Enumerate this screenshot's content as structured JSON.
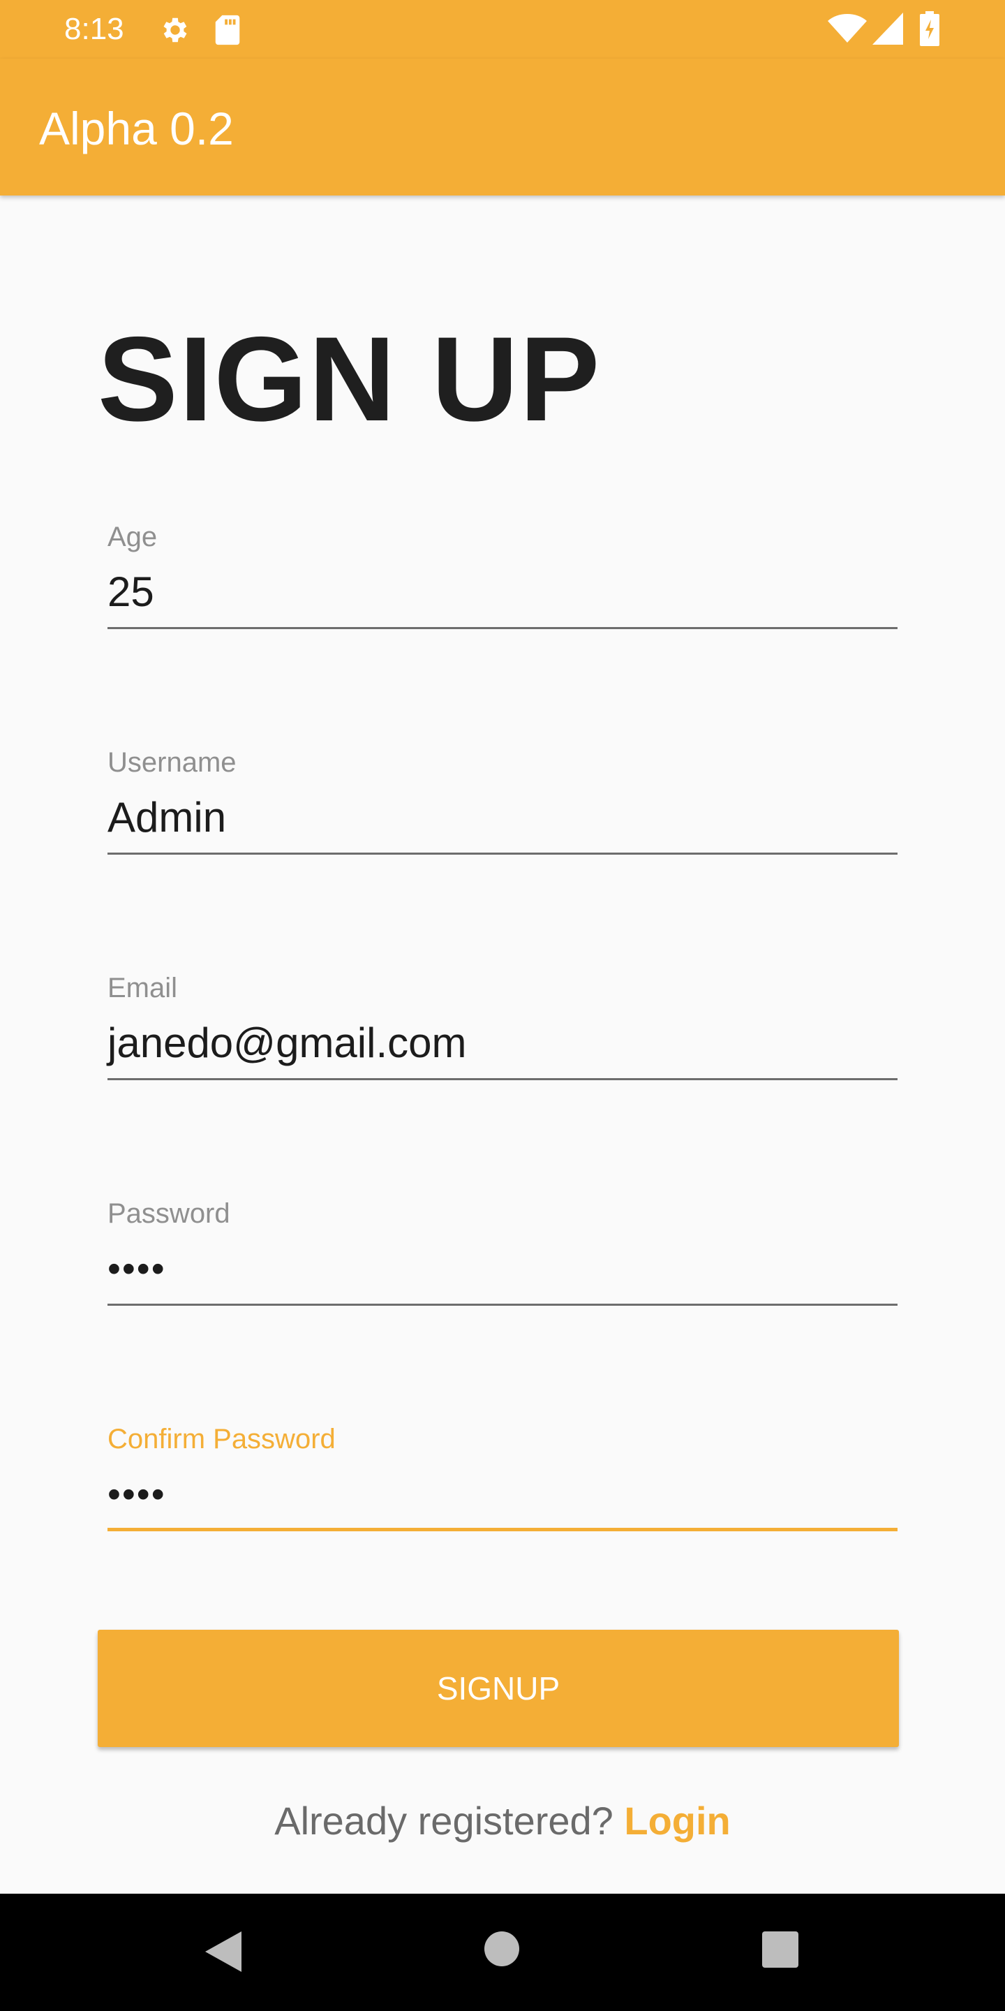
{
  "status_bar": {
    "time": "8:13",
    "left_icons": [
      "gear-icon",
      "sd-card-icon"
    ],
    "right_icons": [
      "wifi-icon",
      "cellular-signal-icon",
      "battery-charging-icon"
    ]
  },
  "app_bar": {
    "title": "Alpha 0.2"
  },
  "page": {
    "heading": "SIGN UP"
  },
  "form": {
    "fields": [
      {
        "label": "Age",
        "value": "25",
        "type": "text"
      },
      {
        "label": "Username",
        "value": "Admin",
        "type": "text"
      },
      {
        "label": "Email",
        "value": "janedo@gmail.com",
        "type": "email"
      },
      {
        "label": "Password",
        "value": "••••",
        "type": "password"
      },
      {
        "label": "Confirm Password",
        "value": "••••",
        "type": "password",
        "focused": true
      }
    ],
    "submit_label": "SIGNUP"
  },
  "footer": {
    "prompt": "Already registered? ",
    "login_label": "Login"
  },
  "nav_bar": {
    "buttons": [
      "back-icon",
      "home-icon",
      "recents-icon"
    ]
  },
  "colors": {
    "accent": "#f4ae36",
    "text_primary": "#1c1c1c",
    "label": "#8f8f8f",
    "background": "#fafafa"
  }
}
